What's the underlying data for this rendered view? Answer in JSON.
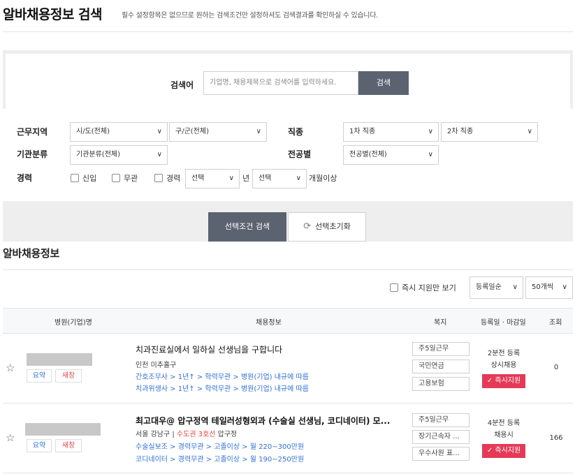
{
  "header": {
    "title": "알바채용정보 검색",
    "subtitle": "필수 설정항목은 없으므로 원하는 검색조건만 설정하셔도 검색결과를 확인하실 수 있습니다."
  },
  "keyword": {
    "label": "검색어",
    "placeholder": "기업명, 채용제목으로 검색어를 입력하세요.",
    "button": "검색"
  },
  "filters": {
    "region_label": "근무지역",
    "region_city": "시/도(전체)",
    "region_district": "구/군(전체)",
    "job_label": "직종",
    "job_primary": "1차 직종",
    "job_secondary": "2차 직종",
    "org_label": "기관분류",
    "org_value": "기관분류(전체)",
    "major_label": "전공별",
    "major_value": "전공별(전체)",
    "career_label": "경력",
    "career_new": "신입",
    "career_none": "무관",
    "career_exp": "경력",
    "career_year_value": "선택",
    "career_year_unit": "년",
    "career_month_value": "선택",
    "career_month_unit": "개월이상"
  },
  "actions": {
    "search": "선택조건 검색",
    "reset": "선택초기화"
  },
  "list": {
    "title": "알바채용정보",
    "instant_only": "즉시 지원만 보기",
    "sort": "등록일순",
    "per_page": "50개씩",
    "columns": [
      "병원(기업)명",
      "채용정보",
      "복지",
      "등록일 · 마감일",
      "조회"
    ]
  },
  "rows": [
    {
      "title": "치과진료실에서 일하실 선생님을 구합니다",
      "location": "인천 미추홀구",
      "subway": "",
      "subway_station": "",
      "lines": [
        "간호조무사 > 1년↑ > 학력무관 > 병원(기업) 내규에 따름",
        "치과위생사 > 1년↑ > 학력무관 > 병원(기업) 내규에 따름"
      ],
      "welfare": [
        "주5일근무",
        "국민연금",
        "고용보험"
      ],
      "registered": "2분전 등록",
      "deadline": "상시채용",
      "apply": "✓ 즉시지원",
      "views": "0",
      "tag_summary": "요약",
      "tag_new": "새창"
    },
    {
      "title": "최고대우@ 압구정역 테일러성형외과 (수술실 선생님, 코디네이터) 모...",
      "location": "서울 강남구",
      "subway": "수도권 3호선",
      "subway_station": "압구정",
      "lines": [
        "수술실보조 > 경력무관 > 고졸이상 > 월 220~300만원",
        "코디네이터 > 경력무관 > 고졸이상 > 월 190~250만원"
      ],
      "welfare": [
        "주5일근무",
        "장기근속자 ...",
        "우수사원 표..."
      ],
      "registered": "4분전 등록",
      "deadline": "채용시",
      "apply": "✓ 즉시지원",
      "views": "166",
      "tag_summary": "요약",
      "tag_new": "새창"
    }
  ]
}
